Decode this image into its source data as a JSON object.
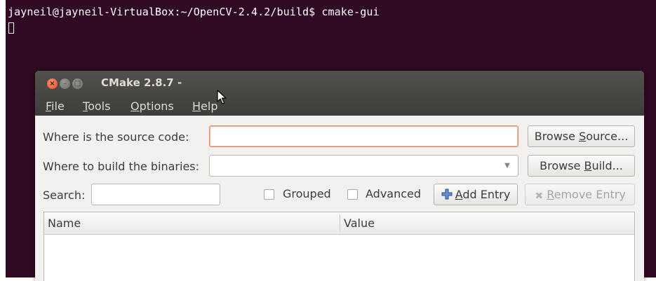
{
  "terminal": {
    "prompt_line": "jayneil@jayneil-VirtualBox:~/OpenCV-2.4.2/build$ cmake-gui"
  },
  "window": {
    "title": "CMake 2.8.7 -",
    "controls": {
      "close": "×",
      "minimize": "–",
      "maximize": "□"
    }
  },
  "menu": [
    {
      "accel": "F",
      "rest": "ile"
    },
    {
      "accel": "T",
      "rest": "ools"
    },
    {
      "accel": "O",
      "rest": "ptions"
    },
    {
      "accel": "H",
      "rest": "elp"
    }
  ],
  "source": {
    "label": "Where is the source code:",
    "value": "",
    "button_pre": "Browse ",
    "button_accel": "S",
    "button_post": "ource..."
  },
  "build": {
    "label": "Where to build the binaries:",
    "value": "",
    "button_pre": "Browse ",
    "button_accel": "B",
    "button_post": "uild..."
  },
  "search": {
    "label": "Search:",
    "value": ""
  },
  "options": {
    "grouped": {
      "label": "Grouped",
      "checked": false
    },
    "advanced": {
      "label": "Advanced",
      "checked": false
    }
  },
  "add_entry": {
    "accel": "A",
    "rest": "dd Entry"
  },
  "remove_entry": {
    "accel": "R",
    "rest": "emove Entry"
  },
  "table": {
    "columns": [
      "Name",
      "Value"
    ]
  },
  "colors": {
    "terminal_bg": "#300a24",
    "focus_border": "#e08a68",
    "titlebar": "#3e3d39",
    "close_button": "#e2531f"
  }
}
